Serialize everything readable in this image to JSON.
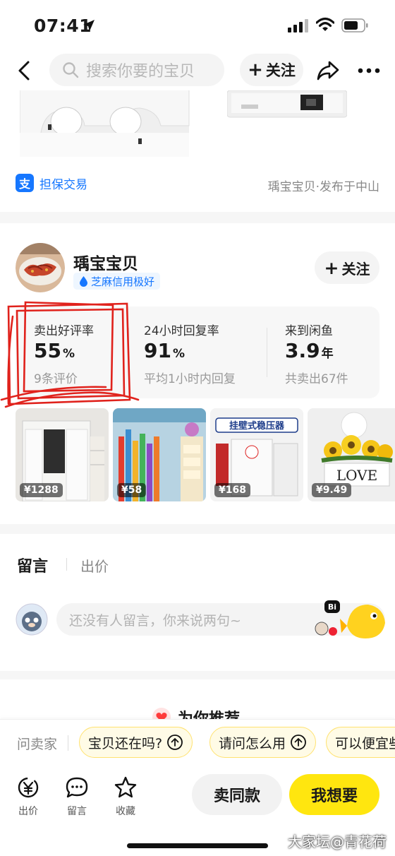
{
  "status_bar": {
    "time": "07:41"
  },
  "nav": {
    "search_placeholder": "搜索你要的宝贝",
    "follow_label": "关注"
  },
  "listing": {
    "guarantee_label": "担保交易",
    "publish_info": "瑀宝宝贝·发布于中山"
  },
  "seller": {
    "name": "瑀宝宝贝",
    "credit_badge": "芝麻信用极好",
    "follow_label": "关注",
    "stats": [
      {
        "label": "卖出好评率",
        "value": "55",
        "unit": "%",
        "sub": "9条评价"
      },
      {
        "label": "24小时回复率",
        "value": "91",
        "unit": "%",
        "sub": "平均1小时内回复"
      },
      {
        "label": "来到闲鱼",
        "value": "3.9",
        "unit": "年",
        "sub": "共卖出67件"
      }
    ],
    "items": [
      {
        "price": "¥1288"
      },
      {
        "price": "¥58"
      },
      {
        "price": "¥168"
      },
      {
        "price": "¥9.49"
      }
    ],
    "item3_banner": "挂壁式稳压器",
    "item4_text": "LOVE"
  },
  "comments": {
    "tab_comments": "留言",
    "tab_offers": "出价",
    "input_placeholder": "还没有人留言，你来说两句~"
  },
  "recommend": {
    "title": "为你推荐"
  },
  "quick_questions": {
    "label": "问卖家",
    "chips": [
      "宝贝还在吗?",
      "请问怎么用",
      "可以便宜些吗"
    ]
  },
  "toolbar": {
    "bid_label": "出价",
    "comment_label": "留言",
    "favorite_label": "收藏",
    "same_label": "卖同款",
    "want_label": "我想要"
  },
  "watermark": "大家坛@青花荷",
  "colors": {
    "accent_yellow": "#ffe60f",
    "link_blue": "#1677ff",
    "annotation_red": "#e0221c"
  }
}
